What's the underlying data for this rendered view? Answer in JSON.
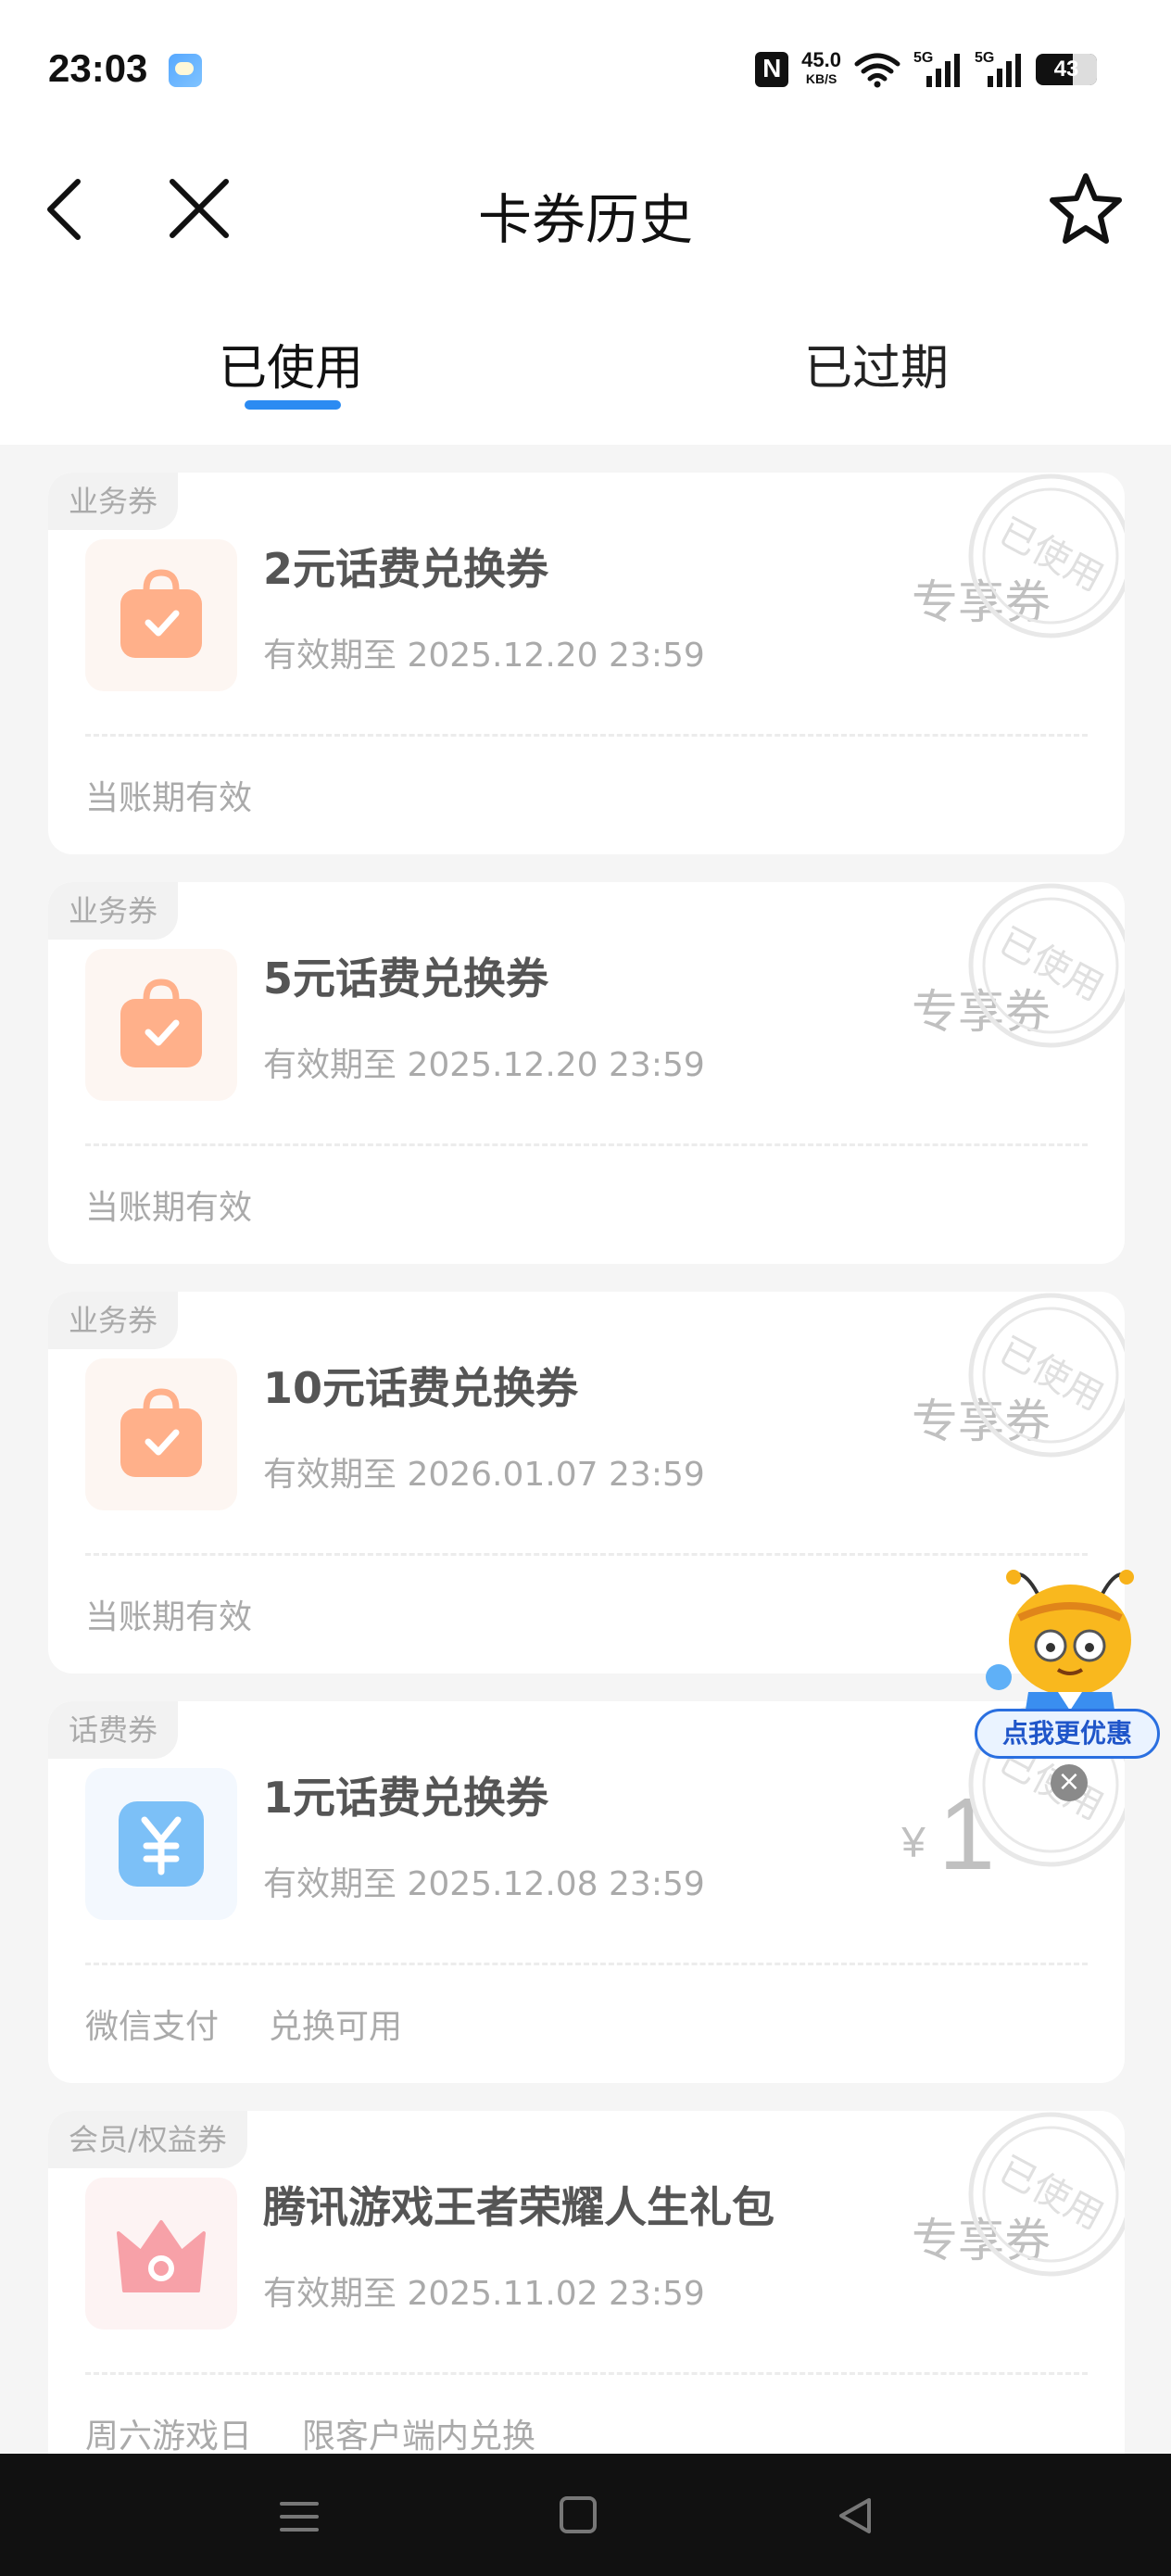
{
  "status": {
    "time": "23:03",
    "speed_value": "45.0",
    "speed_unit": "KB/S",
    "sig1": "5G",
    "sig2": "5G",
    "battery": "43"
  },
  "header": {
    "title": "卡券历史"
  },
  "tabs": [
    {
      "label": "已使用",
      "active": true
    },
    {
      "label": "已过期",
      "active": false
    }
  ],
  "stamp_text": "已使用",
  "coupons": [
    {
      "tag": "业务券",
      "name": "2元话费兑换券",
      "expiry": "有效期至 2025.12.20 23:59",
      "value": "专享券",
      "footer": [
        "当账期有效"
      ],
      "icon": "shopping-bag-icon"
    },
    {
      "tag": "业务券",
      "name": "5元话费兑换券",
      "expiry": "有效期至 2025.12.20 23:59",
      "value": "专享券",
      "footer": [
        "当账期有效"
      ],
      "icon": "shopping-bag-icon"
    },
    {
      "tag": "业务券",
      "name": "10元话费兑换券",
      "expiry": "有效期至 2026.01.07 23:59",
      "value": "专享券",
      "footer": [
        "当账期有效"
      ],
      "icon": "shopping-bag-icon"
    },
    {
      "tag": "话费券",
      "name": "1元话费兑换券",
      "expiry": "有效期至 2025.12.08 23:59",
      "currency": "¥",
      "amount": "1",
      "footer": [
        "微信支付",
        "兑换可用"
      ],
      "icon": "yuan-coin-icon"
    },
    {
      "tag": "会员/权益券",
      "name": "腾讯游戏王者荣耀人生礼包",
      "expiry": "有效期至 2025.11.02 23:59",
      "value": "专享券",
      "footer": [
        "周六游戏日",
        "限客户端内兑换"
      ],
      "icon": "crown-icon"
    }
  ],
  "floating": {
    "button_label": "点我更优惠",
    "close": "×"
  },
  "colors": {
    "accent": "#2b8bf2",
    "bag": "#ffb08a",
    "yuan": "#7cc0f7",
    "crown": "#f7a1a8"
  }
}
